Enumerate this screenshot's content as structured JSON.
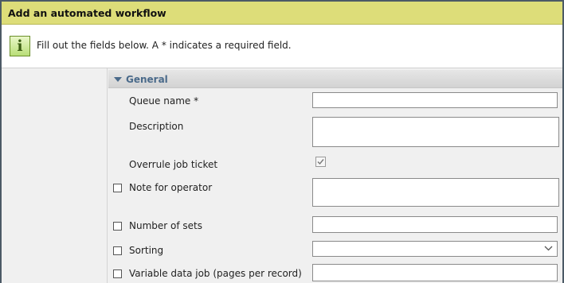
{
  "window": {
    "title": "Add an automated workflow"
  },
  "info": {
    "icon": "info-icon",
    "icon_glyph": "i",
    "text": "Fill out the fields below. A * indicates a required field."
  },
  "section": {
    "label": "General",
    "expanded": true
  },
  "fields": {
    "queue_name": {
      "label": "Queue name *",
      "value": ""
    },
    "description": {
      "label": "Description",
      "value": ""
    },
    "overrule_job_ticket": {
      "label": "Overrule job ticket",
      "checked": true
    },
    "note_for_operator": {
      "label": "Note for operator",
      "enabled": false,
      "value": ""
    },
    "number_of_sets": {
      "label": "Number of sets",
      "enabled": false,
      "value": ""
    },
    "sorting": {
      "label": "Sorting",
      "enabled": false,
      "value": ""
    },
    "variable_data_job": {
      "label": "Variable data job (pages per record)",
      "enabled": false,
      "value": ""
    }
  }
}
